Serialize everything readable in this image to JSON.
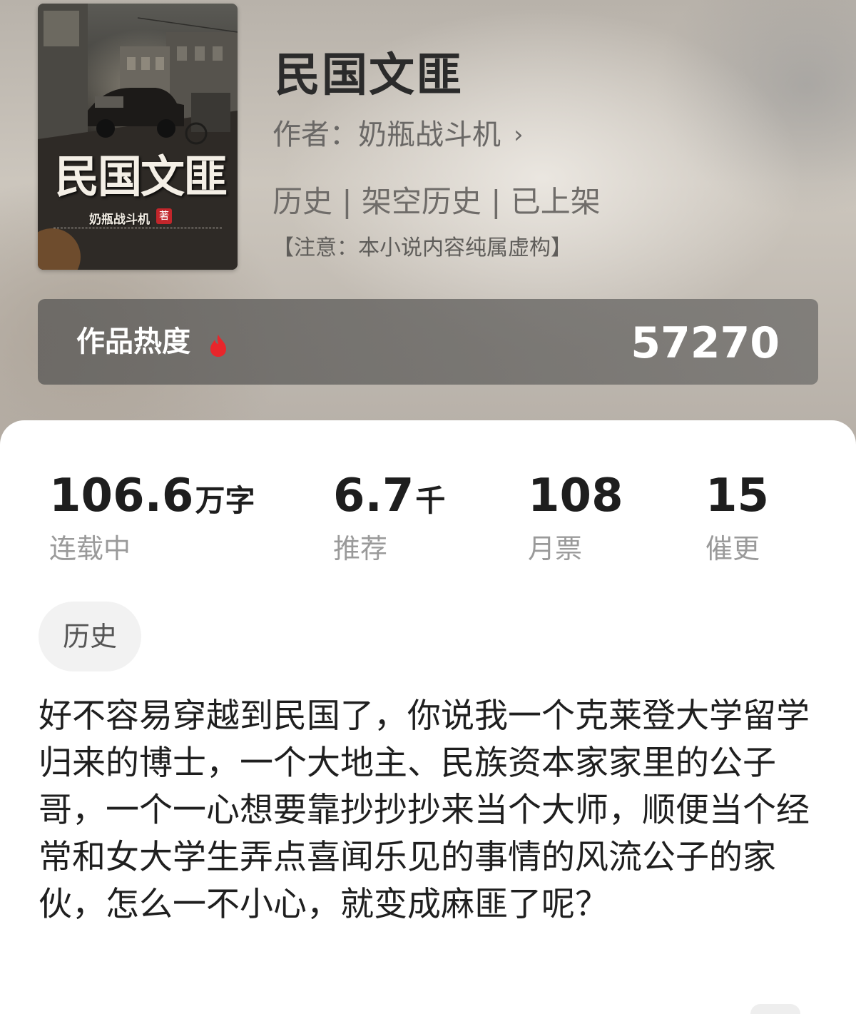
{
  "book": {
    "cover": {
      "title": "民国文匪",
      "author": "奶瓶战斗机",
      "seal": "著"
    },
    "title": "民国文匪",
    "author_line": "作者：奶瓶战斗机",
    "tags_line": "历史 | 架空历史 | 已上架",
    "notice": "【注意：本小说内容纯属虚构】"
  },
  "heat": {
    "label": "作品热度",
    "value": "57270",
    "icon": "fire-icon",
    "icon_color": "#e8262b"
  },
  "stats": [
    {
      "number": "106.6",
      "unit": "万字",
      "label": "连载中"
    },
    {
      "number": "6.7",
      "unit": "千",
      "label": "推荐"
    },
    {
      "number": "108",
      "unit": "",
      "label": "月票"
    },
    {
      "number": "15",
      "unit": "",
      "label": "催更"
    }
  ],
  "genre_chip": "历史",
  "description": "好不容易穿越到民国了，你说我一个克莱登大学留学归来的博士，一个大地主、民族资本家家里的公子哥，一个一心想要靠抄抄抄来当个大师，顺便当个经常和女大学生弄点喜闻乐见的事情的风流公子的家伙，怎么一不小心，就变成麻匪了呢？"
}
